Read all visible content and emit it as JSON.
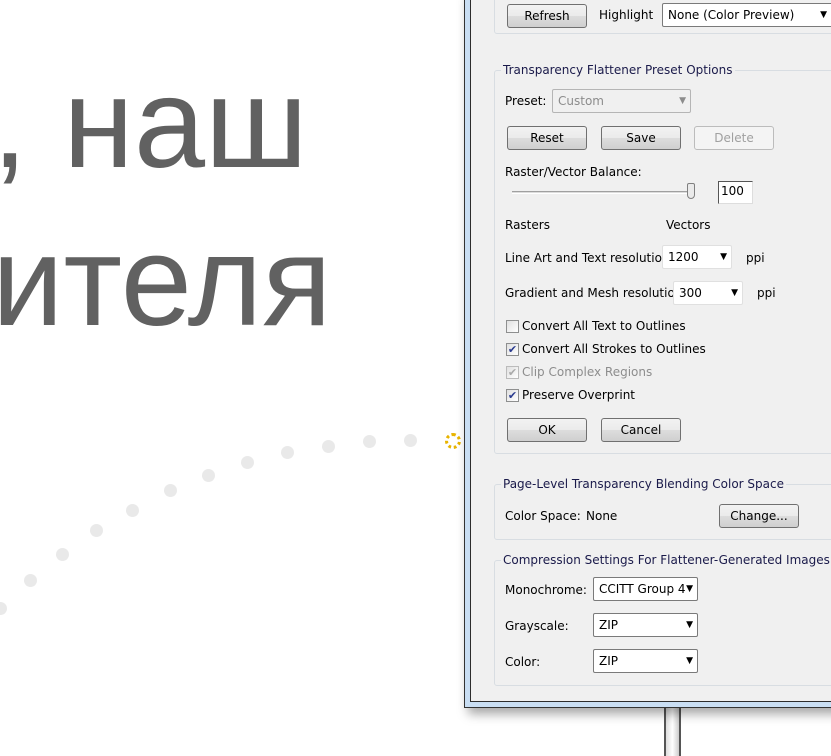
{
  "background": {
    "text_line1": ", наш",
    "text_line2": "ителя",
    "text_color": "#616161"
  },
  "dialog": {
    "top": {
      "refresh": "Refresh",
      "highlight_label": "Highlight",
      "highlight_value": "None (Color Preview)"
    },
    "preset_group": {
      "title": "Transparency Flattener Preset Options",
      "preset_label": "Preset:",
      "preset_value": "Custom",
      "reset": "Reset",
      "save": "Save",
      "delete": "Delete",
      "balance_label": "Raster/Vector Balance:",
      "balance_value": "100",
      "balance_percent": 100,
      "rasters": "Rasters",
      "vectors": "Vectors",
      "lineart_label": "Line Art and Text resolution:",
      "lineart_value": "1200",
      "lineart_unit": "ppi",
      "gradient_label": "Gradient and Mesh resolution:",
      "gradient_value": "300",
      "gradient_unit": "ppi",
      "checkboxes": [
        {
          "label": "Convert All Text to Outlines",
          "checked": false
        },
        {
          "label": "Convert All Strokes to Outlines",
          "checked": true
        },
        {
          "label": "Clip Complex Regions",
          "checked": true,
          "disabled": true
        },
        {
          "label": "Preserve Overprint",
          "checked": true
        }
      ],
      "ok": "OK",
      "cancel": "Cancel"
    },
    "blend_group": {
      "title": "Page-Level Transparency Blending Color Space",
      "label": "Color Space:",
      "value": "None",
      "change": "Change..."
    },
    "compression_group": {
      "title": "Compression Settings For Flattener-Generated Images:",
      "monochrome_label": "Monochrome:",
      "monochrome_value": "CCITT Group 4",
      "grayscale_label": "Grayscale:",
      "grayscale_value": "ZIP",
      "color_label": "Color:",
      "color_value": "ZIP"
    }
  }
}
